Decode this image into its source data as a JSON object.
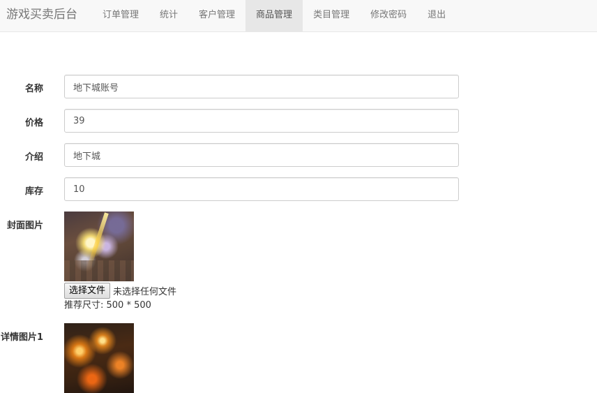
{
  "navbar": {
    "brand": "游戏买卖后台",
    "items": [
      {
        "label": "订单管理",
        "active": false
      },
      {
        "label": "统计",
        "active": false
      },
      {
        "label": "客户管理",
        "active": false
      },
      {
        "label": "商品管理",
        "active": true
      },
      {
        "label": "类目管理",
        "active": false
      },
      {
        "label": "修改密码",
        "active": false
      },
      {
        "label": "退出",
        "active": false
      }
    ]
  },
  "form": {
    "name": {
      "label": "名称",
      "value": "地下城账号"
    },
    "price": {
      "label": "价格",
      "value": "39"
    },
    "intro": {
      "label": "介绍",
      "value": "地下城"
    },
    "stock": {
      "label": "库存",
      "value": "10"
    },
    "cover": {
      "label": "封面图片",
      "choose_button": "选择文件",
      "file_status": "未选择任何文件",
      "hint": "推荐尺寸: 500 * 500"
    },
    "detail1": {
      "label": "详情图片1"
    }
  }
}
